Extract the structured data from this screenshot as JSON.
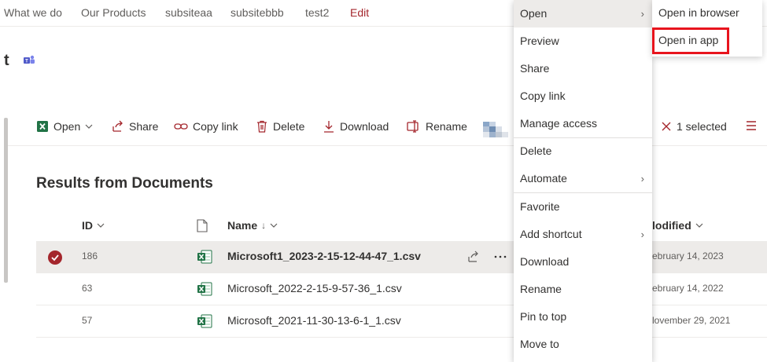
{
  "topnav": {
    "items": [
      "What we do",
      "Our Products",
      "subsiteaa",
      "subsitebbb",
      "test2"
    ],
    "edit_label": "Edit"
  },
  "site": {
    "title_fragment": "t"
  },
  "commandbar": {
    "open": "Open",
    "share": "Share",
    "copy_link": "Copy link",
    "delete": "Delete",
    "download": "Download",
    "rename": "Rename",
    "selected": "1 selected"
  },
  "results": {
    "title": "Results from Documents",
    "columns": {
      "id": "ID",
      "name": "Name",
      "name_sort": "↓",
      "modified": "lodified"
    },
    "rows": [
      {
        "id": "186",
        "name": "Microsoft1_2023-2-15-12-44-47_1.csv",
        "modified": "ebruary 14, 2023",
        "selected": true
      },
      {
        "id": "63",
        "name": "Microsoft_2022-2-15-9-57-36_1.csv",
        "modified": "ebruary 14, 2022",
        "selected": false
      },
      {
        "id": "57",
        "name": "Microsoft_2021-11-30-13-6-1_1.csv",
        "modified": "lovember 29, 2021",
        "selected": false
      }
    ]
  },
  "context_menu": {
    "items": [
      {
        "label": "Open",
        "has_submenu": true
      },
      {
        "label": "Preview",
        "has_submenu": false
      },
      {
        "label": "Share",
        "has_submenu": false
      },
      {
        "label": "Copy link",
        "has_submenu": false
      },
      {
        "label": "Manage access",
        "has_submenu": false
      },
      {
        "label": "Delete",
        "has_submenu": false
      },
      {
        "label": "Automate",
        "has_submenu": true
      },
      {
        "label": "Favorite",
        "has_submenu": false
      },
      {
        "label": "Add shortcut",
        "has_submenu": true
      },
      {
        "label": "Download",
        "has_submenu": false
      },
      {
        "label": "Rename",
        "has_submenu": false
      },
      {
        "label": "Pin to top",
        "has_submenu": false
      },
      {
        "label": "Move to",
        "has_submenu": false
      }
    ]
  },
  "open_submenu": {
    "items": [
      "Open in browser",
      "Open in app"
    ],
    "highlighted": "Open in app"
  },
  "colors": {
    "accent_red": "#a4262c",
    "highlight_border": "#e8141d",
    "excel_green": "#217346",
    "selected_row_bg": "#edebe9"
  }
}
